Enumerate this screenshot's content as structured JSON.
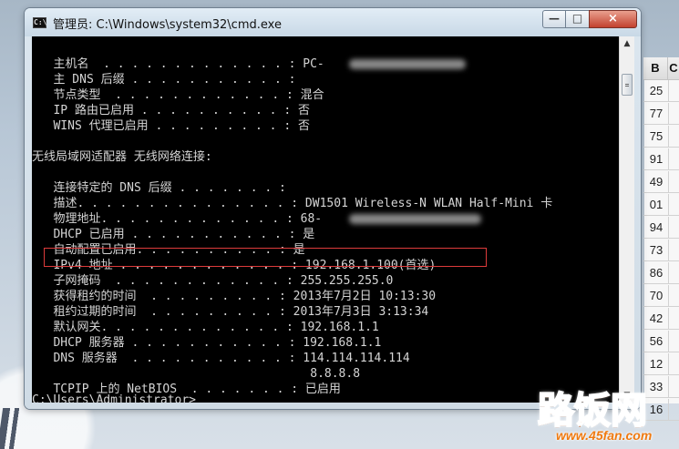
{
  "window": {
    "title": "管理员: C:\\Windows\\system32\\cmd.exe",
    "icon": "C:\\",
    "controls": {
      "minimize": "—",
      "maximize": "□",
      "close": "×"
    }
  },
  "console": {
    "lines": [
      "   主机名  . . . . . . . . . . . . . : PC-",
      "   主 DNS 后缀 . . . . . . . . . . . :",
      "   节点类型  . . . . . . . . . . . . : 混合",
      "   IP 路由已启用 . . . . . . . . . . : 否",
      "   WINS 代理已启用 . . . . . . . . . : 否",
      "",
      "无线局域网适配器 无线网络连接:",
      "",
      "   连接特定的 DNS 后缀 . . . . . . . :",
      "   描述. . . . . . . . . . . . . . . : DW1501 Wireless-N WLAN Half-Mini 卡",
      "   物理地址. . . . . . . . . . . . . : 68-",
      "   DHCP 已启用 . . . . . . . . . . . : 是",
      "   自动配置已启用. . . . . . . . . . : 是",
      "   IPv4 地址 . . . . . . . . . . . . : 192.168.1.100(首选)",
      "   子网掩码  . . . . . . . . . . . . : 255.255.255.0",
      "   获得租约的时间  . . . . . . . . . : 2013年7月2日 10:13:30",
      "   租约过期的时间  . . . . . . . . . : 2013年7月3日 3:13:34",
      "   默认网关. . . . . . . . . . . . . : 192.168.1.1",
      "   DHCP 服务器 . . . . . . . . . . . : 192.168.1.1",
      "   DNS 服务器  . . . . . . . . . . . : 114.114.114.114",
      "                                       8.8.8.8",
      "   TCPIP 上的 NetBIOS  . . . . . . . : 已启用",
      "",
      "C:\\Users\\Administrator>"
    ]
  },
  "background_sheet": {
    "header_1": "B",
    "header_2": "C",
    "values": [
      "25",
      "77",
      "75",
      "91",
      "49",
      "01",
      "94",
      "73",
      "86",
      "70",
      "42",
      "56",
      "12",
      "33",
      "16"
    ]
  },
  "watermark": {
    "logo": "路饭网",
    "url": "www.45fan.com"
  },
  "colors": {
    "console_background": "#000000",
    "console_text": "#d5d5d5",
    "highlight_border": "#dd3b3b",
    "watermark_orange": "#ff6b00"
  }
}
